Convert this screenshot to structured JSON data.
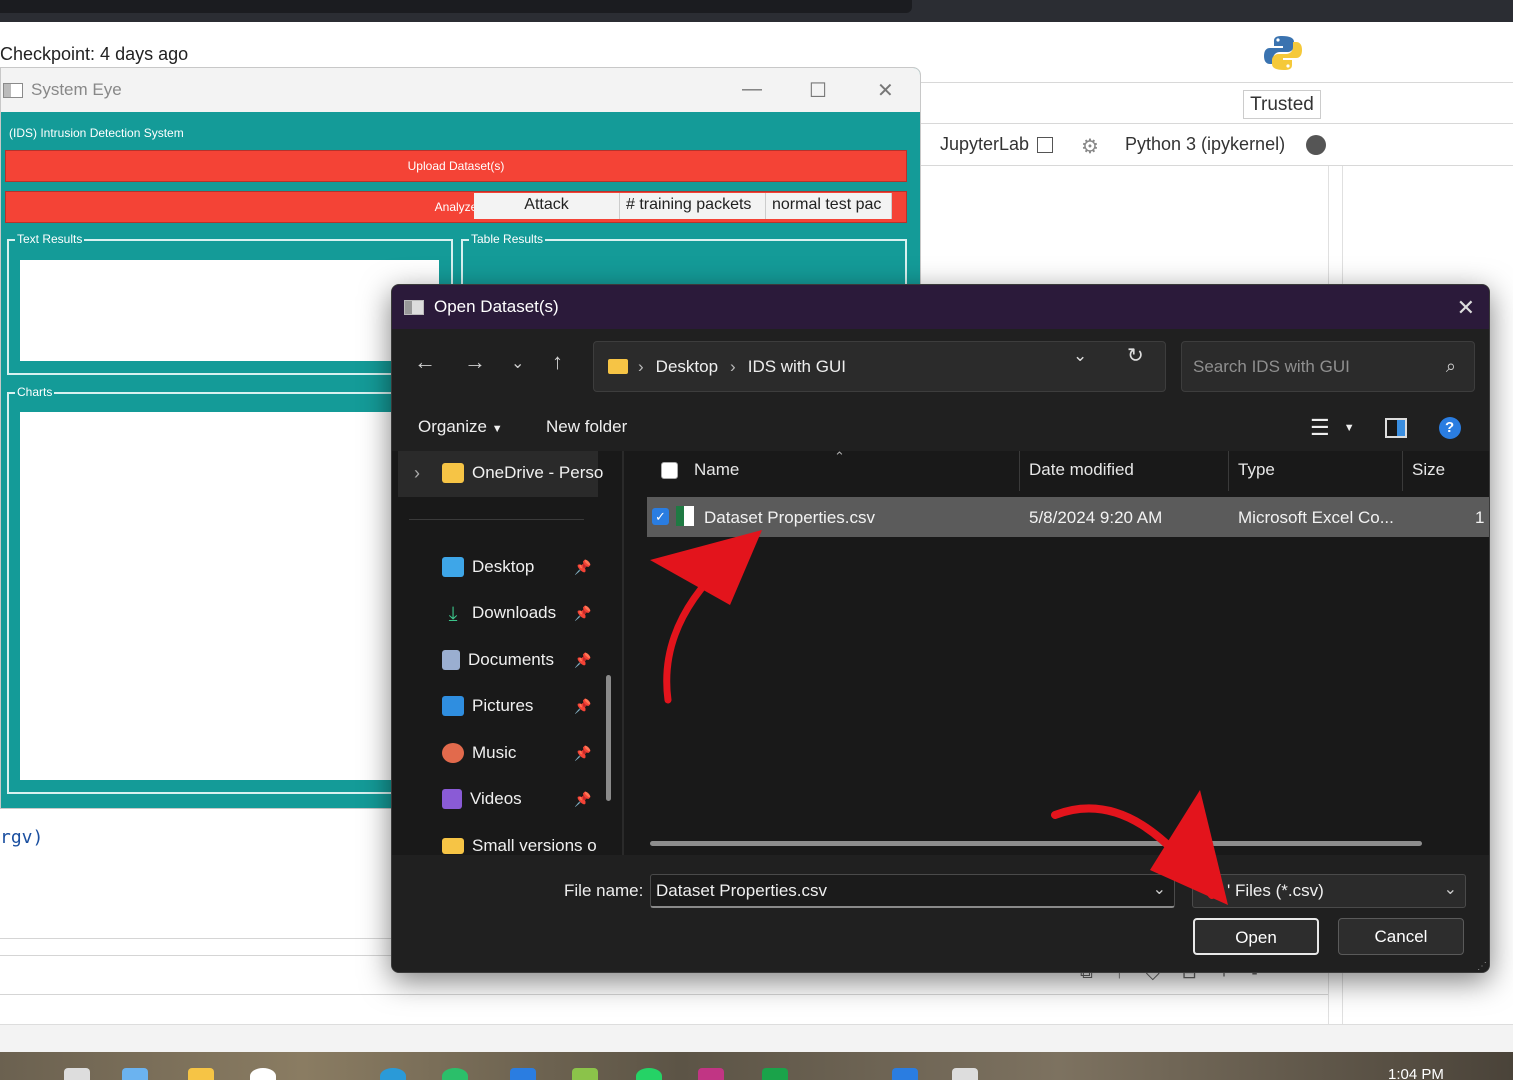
{
  "jupyter": {
    "checkpoint": "Checkpoint: 4 days ago",
    "trusted": "Trusted",
    "jupyterlab": "JupyterLab",
    "kernel": "Python 3 (ipykernel)",
    "code_fragment": "rgv)"
  },
  "system_eye": {
    "title": "System Eye",
    "ids_label": "(IDS) Intrusion Detection System",
    "upload_btn": "Upload Dataset(s)",
    "analyze_btn": "Analyze",
    "text_results": "Text Results",
    "table_results": "Table Results",
    "charts": "Charts",
    "table_columns": [
      "Attack",
      "# training packets",
      "normal test pac"
    ]
  },
  "dialog": {
    "title": "Open Dataset(s)",
    "breadcrumb": [
      "Desktop",
      "IDS with GUI"
    ],
    "search_placeholder": "Search IDS with GUI",
    "organize": "Organize",
    "new_folder": "New folder",
    "sidebar": {
      "onedrive": "OneDrive - Perso",
      "items": [
        {
          "label": "Desktop",
          "icon": "desktop-icon",
          "color": "#3ea6e8"
        },
        {
          "label": "Downloads",
          "icon": "download-icon",
          "color": "#3cc48a"
        },
        {
          "label": "Documents",
          "icon": "documents-icon",
          "color": "#9aaed0"
        },
        {
          "label": "Pictures",
          "icon": "pictures-icon",
          "color": "#2f8ee0"
        },
        {
          "label": "Music",
          "icon": "music-icon",
          "color": "#e26a4c"
        },
        {
          "label": "Videos",
          "icon": "videos-icon",
          "color": "#8a5bd6"
        },
        {
          "label": "Small versions o",
          "icon": "folder-icon",
          "color": "#f6c445"
        }
      ]
    },
    "columns": {
      "name": "Name",
      "date": "Date modified",
      "type": "Type",
      "size": "Size"
    },
    "file": {
      "name": "Dataset Properties.csv",
      "date": "5/8/2024 9:20 AM",
      "type": "Microsoft Excel Co...",
      "size": "1"
    },
    "filename_label": "File name:",
    "filename_value": "Dataset Properties.csv",
    "filter": "' Files (*.csv)",
    "open_btn": "Open",
    "cancel_btn": "Cancel"
  },
  "taskbar": {
    "time": "1:04 PM"
  },
  "colors": {
    "teal": "#149b98",
    "red": "#f44336",
    "dialog_bg": "#191919",
    "annotation": "#e3141c"
  }
}
